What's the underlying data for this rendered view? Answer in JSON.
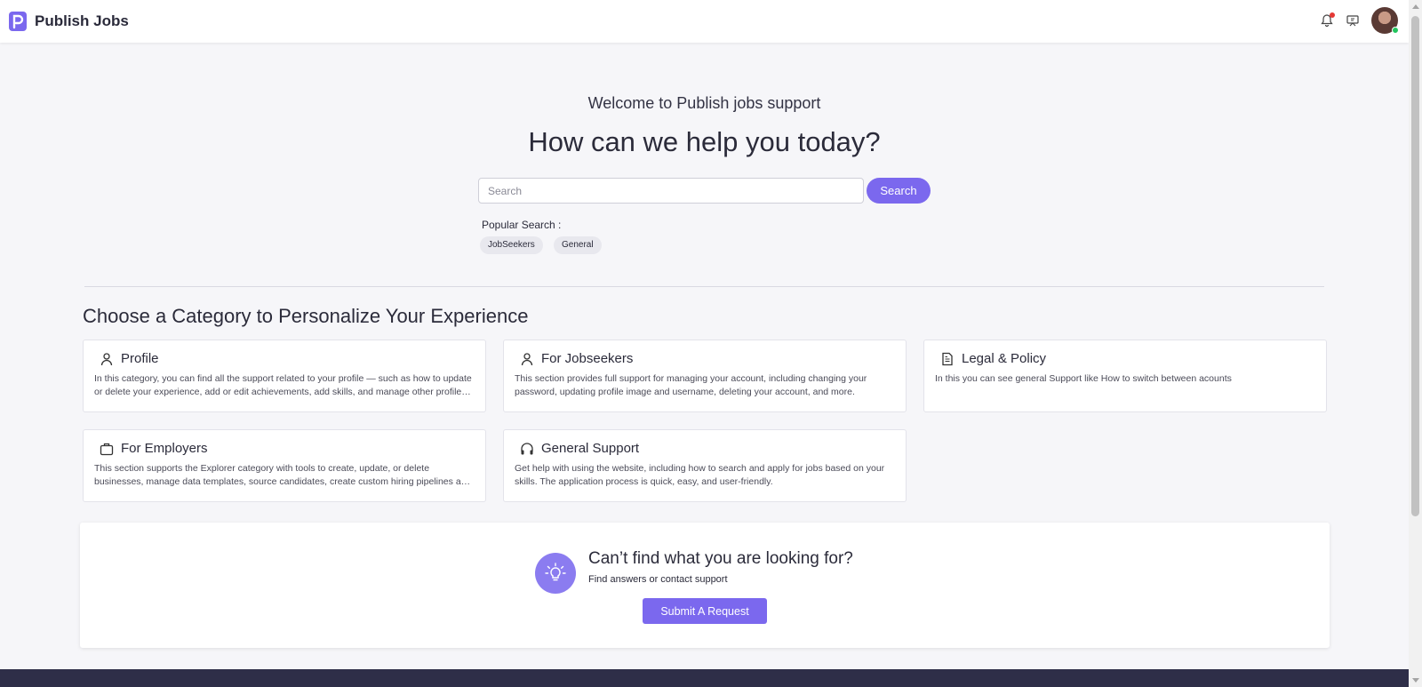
{
  "header": {
    "app_title": "Publish Jobs",
    "icons": [
      "notification-bell-icon",
      "presentation-icon",
      "user-avatar"
    ],
    "brand_color": "#7b68ee"
  },
  "hero": {
    "welcome": "Welcome to Publish jobs support",
    "title": "How can we help you today?",
    "search_placeholder": "Search",
    "search_button": "Search",
    "popular_label": "Popular Search :",
    "popular_tags": [
      "JobSeekers",
      "General"
    ]
  },
  "categories": {
    "title": "Choose a Category to Personalize Your Experience",
    "items": [
      {
        "icon": "person-icon",
        "title": "Profile",
        "description": "In this category, you can find all the support related to your profile — such as how to update or delete your experience, add or edit achievements, add skills, and manage other profile details."
      },
      {
        "icon": "person-icon",
        "title": "For Jobseekers",
        "description": "This section provides full support for managing your account, including changing your password, updating profile image and username, deleting your account, and more."
      },
      {
        "icon": "document-icon",
        "title": "Legal & Policy",
        "description": "In this you can see general Support like How to switch between acounts"
      },
      {
        "icon": "briefcase-icon",
        "title": "For Employers",
        "description": "This section supports the Explorer category with tools to create, update, or delete businesses, manage data templates, source candidates, create custom hiring pipelines and more."
      },
      {
        "icon": "headphones-icon",
        "title": "General Support",
        "description": "Get help with using the website, including how to search and apply for jobs based on your skills. The application process is quick, easy, and user-friendly."
      }
    ]
  },
  "help": {
    "title": "Can’t find what you are looking for?",
    "subtitle": "Find answers or contact support",
    "button": "Submit A Request",
    "icon": "lightbulb-icon"
  },
  "colors": {
    "accent": "#7b68ee",
    "background": "#f6f6f9",
    "footer": "#2e2e48"
  }
}
